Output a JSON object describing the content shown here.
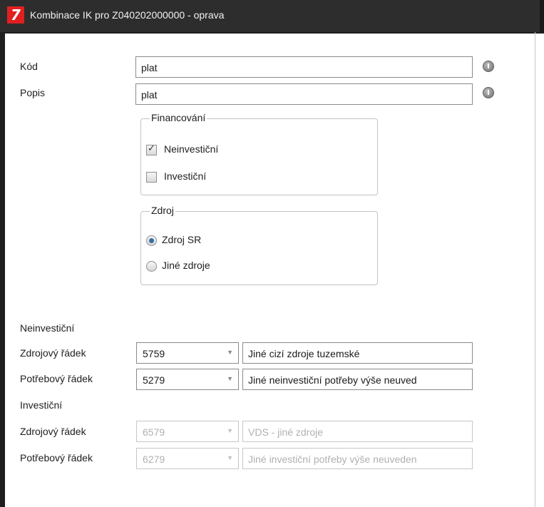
{
  "window": {
    "title": "Kombinace IK pro Z040202000000 - oprava"
  },
  "form": {
    "kod": {
      "label": "Kód",
      "value": "plat"
    },
    "popis": {
      "label": "Popis",
      "value": "plat"
    }
  },
  "financovani": {
    "title": "Financování",
    "options": [
      {
        "label": "Neinvestiční",
        "checked": true
      },
      {
        "label": "Investiční",
        "checked": false
      }
    ]
  },
  "zdroj": {
    "title": "Zdroj",
    "options": [
      {
        "label": "Zdroj SR",
        "selected": true
      },
      {
        "label": "Jiné zdroje",
        "selected": false
      }
    ]
  },
  "neinvesticni": {
    "heading": "Neinvestiční",
    "zdrojovy": {
      "label": "Zdrojový řádek",
      "code": "5759",
      "description": "Jiné cizí zdroje tuzemské"
    },
    "potrebovy": {
      "label": "Potřebový řádek",
      "code": "5279",
      "description": "Jiné neinvestiční potřeby výše neuved"
    }
  },
  "investicni": {
    "heading": "Investiční",
    "zdrojovy": {
      "label": "Zdrojový  řádek",
      "code": "6579",
      "description": "VDS - jiné zdroje"
    },
    "potrebovy": {
      "label": "Potřebový řádek",
      "code": "6279",
      "description": "Jiné investiční potřeby výše neuveden"
    }
  },
  "icons": {
    "info": "info-icon",
    "dropdown": "chevron-down-icon",
    "check": "checkmark-icon",
    "logo": "app-logo"
  }
}
